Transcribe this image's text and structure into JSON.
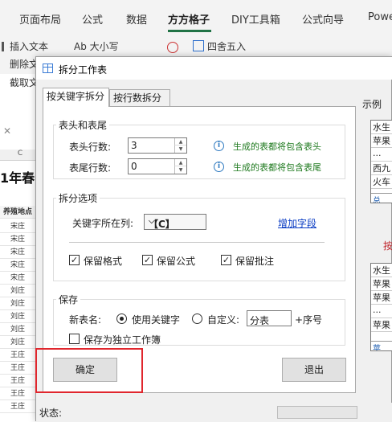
{
  "ribbon": {
    "tabs": [
      "页面布局",
      "公式",
      "数据",
      "方方格子",
      "DIY工具箱",
      "公式向导",
      "Powe"
    ],
    "active_tab": "方方格子",
    "row1": {
      "insert_text": "插入文本",
      "case": "Ab 大小写",
      "round": "四舍五入"
    },
    "row2": {
      "delete": "删除文"
    },
    "row3": {
      "cut": "截取文"
    }
  },
  "sheet": {
    "col_header": "C",
    "title_fragment": "1年春",
    "subheader": "养殖地点",
    "rows": [
      "宋庄",
      "宋庄",
      "宋庄",
      "宋庄",
      "宋庄",
      "刘庄",
      "刘庄",
      "刘庄",
      "刘庄",
      "刘庄",
      "王庄",
      "王庄",
      "王庄",
      "王庄",
      "王庄",
      "王庄",
      "王庄",
      "王庄"
    ]
  },
  "dialog": {
    "title": "拆分工作表",
    "tabs": [
      "按关键字拆分",
      "按行数拆分"
    ],
    "active_tab": "按关键字拆分",
    "header_group": {
      "label": "表头和表尾",
      "header_rows_label": "表头行数:",
      "header_rows_value": "3",
      "header_hint": "生成的表都将包含表头",
      "footer_rows_label": "表尾行数:",
      "footer_rows_value": "0",
      "footer_hint": "生成的表都将包含表尾"
    },
    "split_group": {
      "label": "拆分选项",
      "column_label": "关键字所在列:",
      "column_value": "【C】",
      "add_field_link": "增加字段",
      "keep_format": "保留格式",
      "keep_formula": "保留公式",
      "keep_comment": "保留批注",
      "keep_format_checked": true,
      "keep_formula_checked": true,
      "keep_comment_checked": true
    },
    "save_group": {
      "label": "保存",
      "name_label": "新表名:",
      "use_keyword": "使用关键字",
      "custom": "自定义:",
      "custom_value": "分表",
      "suffix": "+序号",
      "independent": "保存为独立工作簿",
      "use_keyword_selected": true
    },
    "ok_button": "确定",
    "exit_button": "退出",
    "status_label": "状态:",
    "example": {
      "label": "示例",
      "box1": [
        "水生",
        "苹果",
        "...",
        "西九",
        "火车"
      ],
      "box1_tab": "总",
      "mid_text": "按",
      "box2": [
        "水生",
        "苹果",
        "苹果",
        "...",
        "苹果"
      ],
      "box2_tab": "苹"
    },
    "accent_color": "#e0262d",
    "hint_color": "#1f7a1f",
    "link_color": "#0a3cc4"
  }
}
